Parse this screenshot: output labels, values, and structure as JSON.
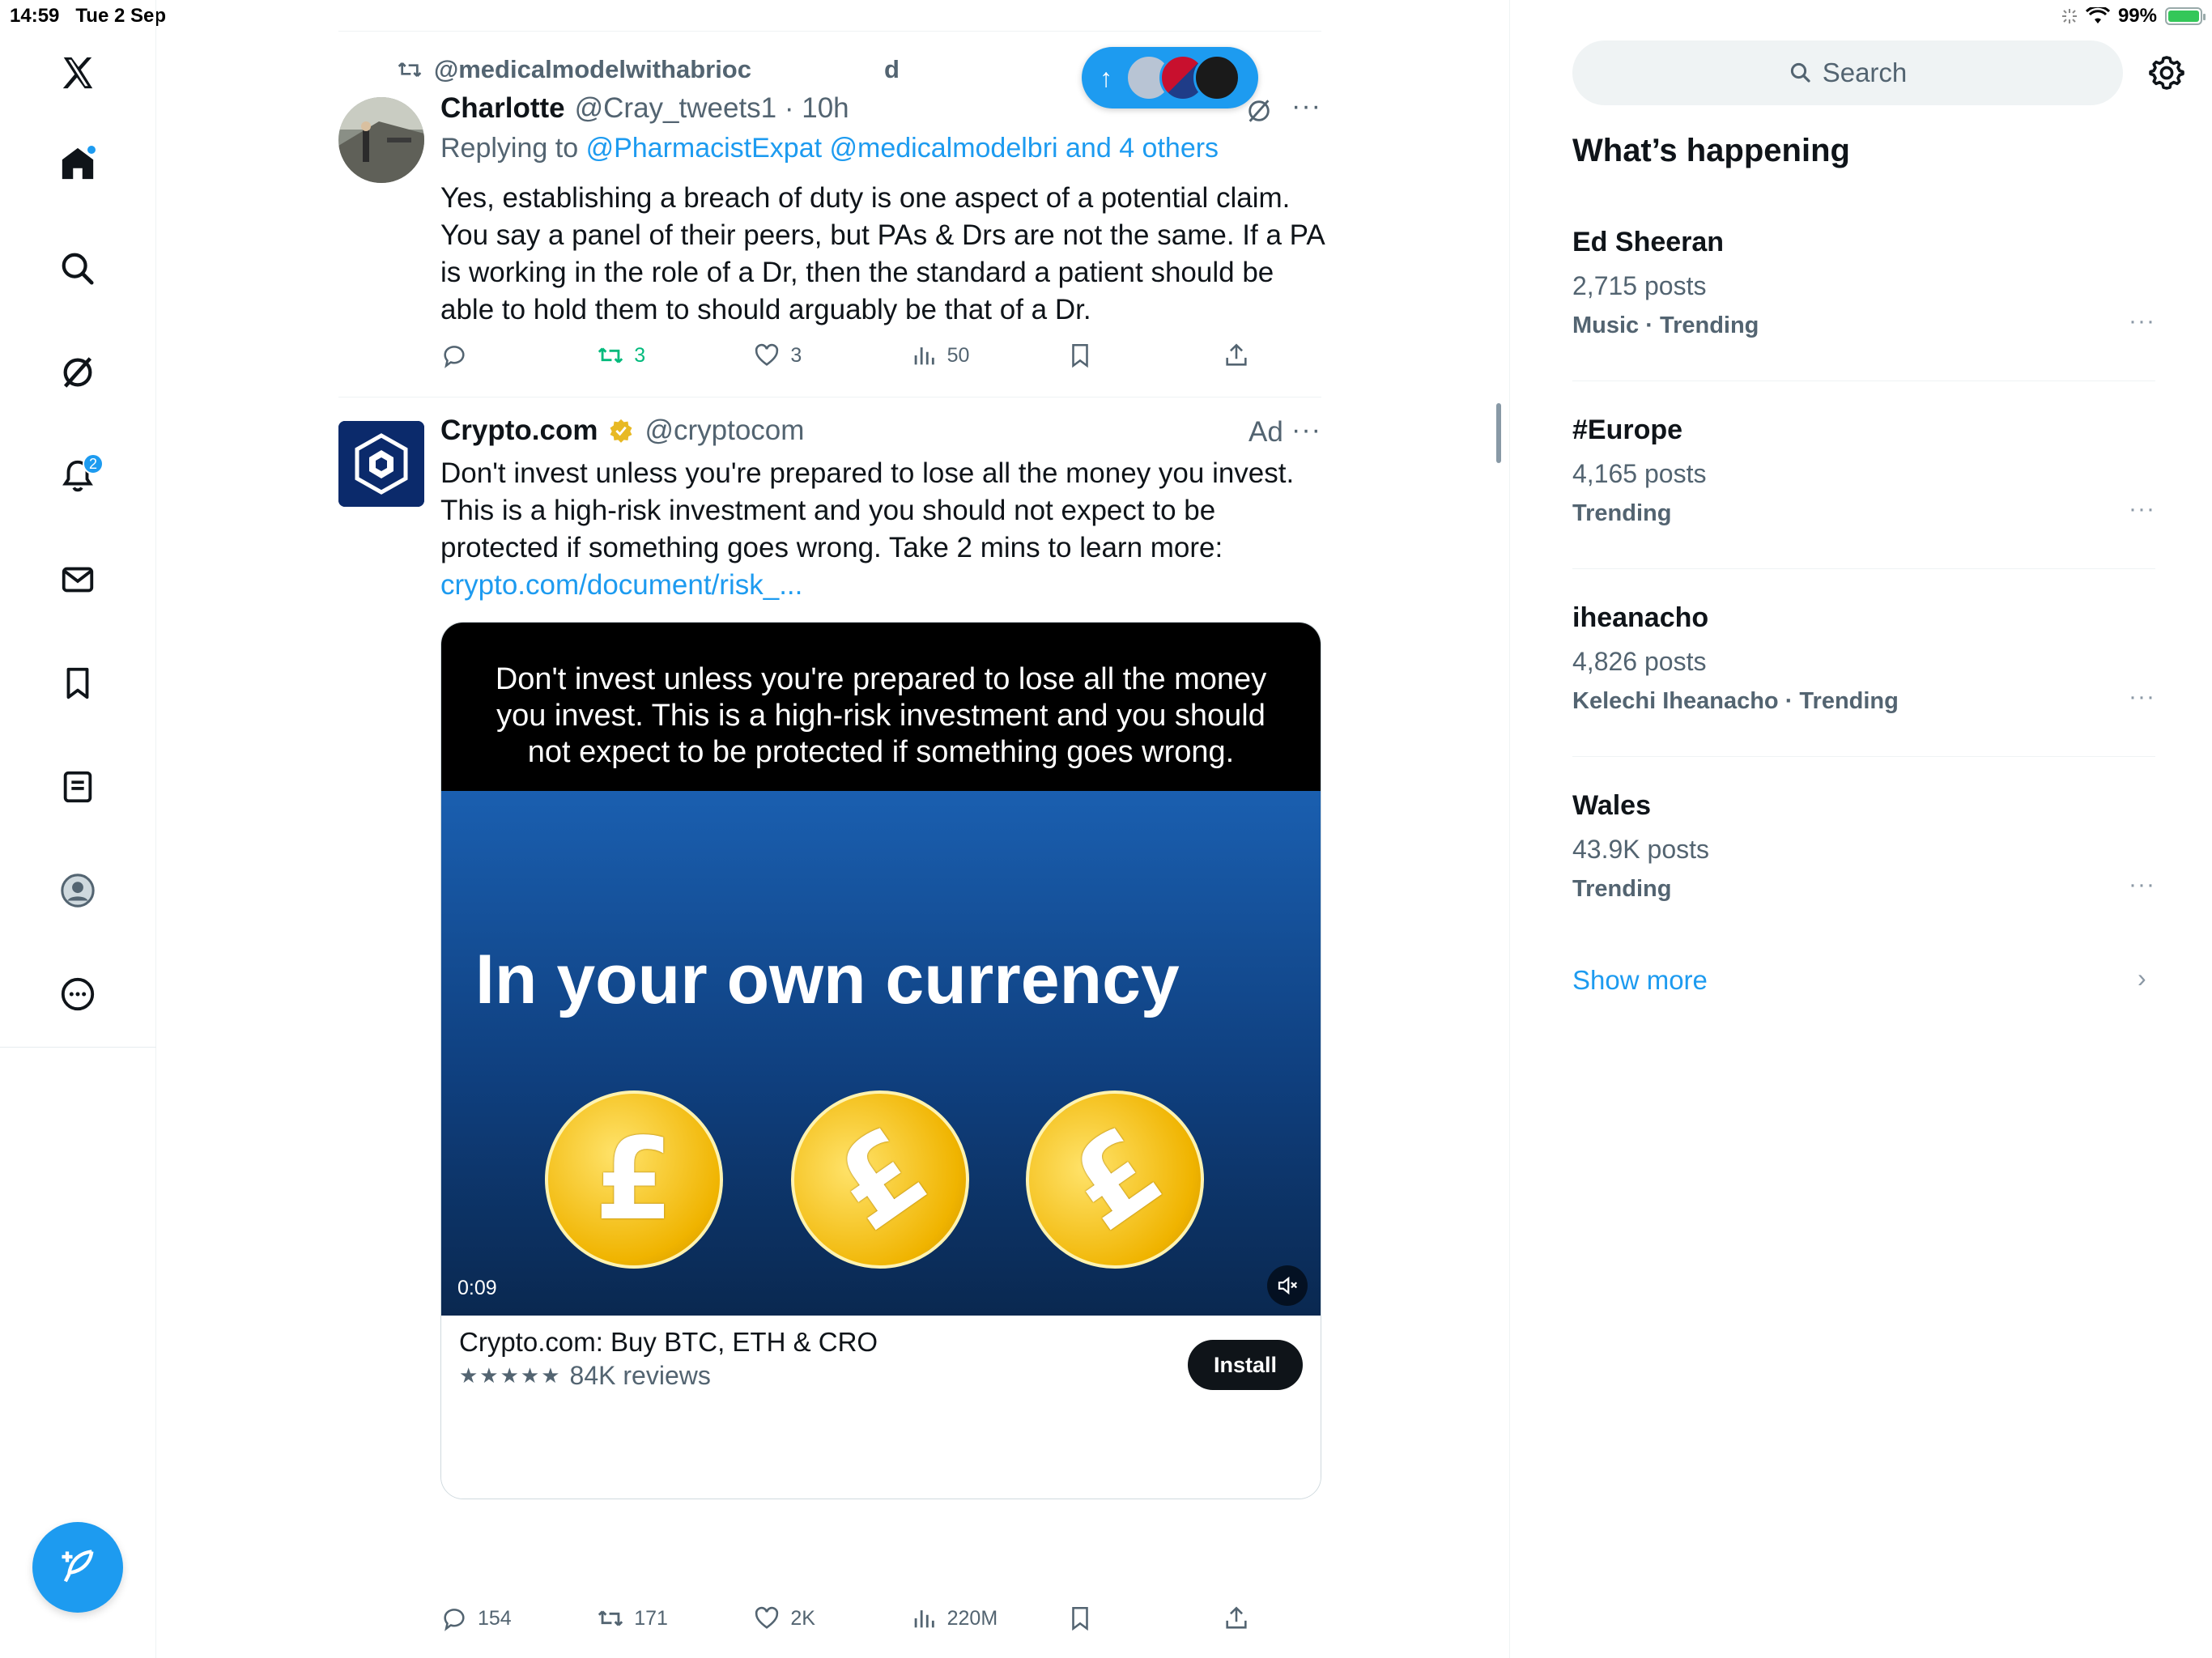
{
  "status_bar": {
    "time": "14:59",
    "date": "Tue 2 Sep",
    "battery": "99%"
  },
  "nav": {
    "notifications_badge": "2",
    "items": [
      "x-logo-icon",
      "home-icon",
      "search-icon",
      "grok-icon",
      "notifications-icon",
      "messages-icon",
      "bookmarks-icon",
      "lists-icon",
      "profile-icon",
      "more-icon"
    ]
  },
  "timeline": {
    "top_actions": {},
    "tweet1": {
      "retweeted_by": "@medicalmodelwithabrioc",
      "retweeted_by_suffix": "d",
      "name": "Charlotte",
      "handle": "@Cray_tweets1 · 10h",
      "replying_label": "Replying to",
      "replying_to": "@PharmacistExpat @medicalmodelbri and 4 others",
      "text": "Yes, establishing a breach of duty is one aspect of a potential claim. You say a panel of their peers, but PAs & Drs are not the same. If a PA is working in the role of a Dr, then the standard a patient should be able to hold them to should arguably be that of a Dr.",
      "more": "···",
      "replies": "",
      "retweets": "3",
      "likes": "3",
      "views": "50"
    },
    "tweet2": {
      "name": "Crypto.com",
      "handle": "@cryptocom",
      "ad_label": "Ad",
      "more": "···",
      "text": "Don't invest unless you're prepared to lose all the money you invest. This is a high-risk investment and you should not expect to be protected if something goes wrong. Take 2 mins to learn more:",
      "link": "crypto.com/document/risk_...",
      "media_disclaimer": "Don't invest unless you're prepared to lose all the money you invest. This is a high-risk investment and you should not expect to be protected if something goes wrong.",
      "media_headline": "In your own currency",
      "coin_symbol": "£",
      "duration": "0:09",
      "app_title": "Crypto.com: Buy BTC, ETH & CRO",
      "app_stars": "★★★★★",
      "app_reviews": "84K reviews",
      "install_label": "Install",
      "replies": "154",
      "retweets": "171",
      "likes": "2K",
      "views": "220M"
    }
  },
  "sidebar": {
    "search_placeholder": "Search",
    "title": "What’s happening",
    "trends": [
      {
        "name": "Ed Sheeran",
        "count": "2,715 posts",
        "category": "Music · Trending"
      },
      {
        "name": "#Europe",
        "count": "4,165 posts",
        "category": "Trending"
      },
      {
        "name": "iheanacho",
        "count": "4,826 posts",
        "category": "Kelechi Iheanacho · Trending"
      },
      {
        "name": "Wales",
        "count": "43.9K posts",
        "category": "Trending"
      }
    ],
    "show_more": "Show more",
    "trend_more": "···"
  },
  "colors": {
    "accent": "#1d9bf0",
    "retweet_green": "#00ba7c",
    "text": "#0f1419",
    "muted": "#536471"
  }
}
